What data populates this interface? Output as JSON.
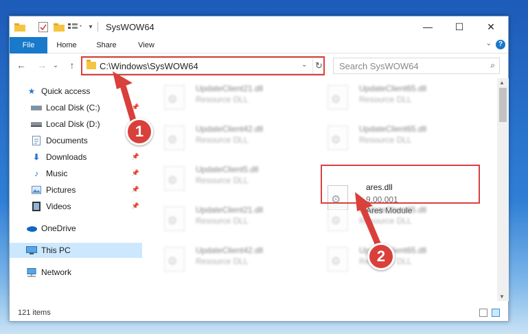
{
  "window": {
    "title": "SysWOW64"
  },
  "title_controls": {
    "minimize": "—",
    "maximize": "☐",
    "close": "✕"
  },
  "ribbon": {
    "tabs": [
      "File",
      "Home",
      "Share",
      "View"
    ],
    "help": "?"
  },
  "address": {
    "path": "C:\\Windows\\SysWOW64"
  },
  "search": {
    "placeholder": "Search SysWOW64"
  },
  "sidebar": {
    "items": [
      {
        "label": "Quick access",
        "icon": "star-icon",
        "pinned": false
      },
      {
        "label": "Local Disk (C:)",
        "icon": "drive-icon",
        "pinned": true
      },
      {
        "label": "Local Disk (D:)",
        "icon": "drive-icon",
        "pinned": true
      },
      {
        "label": "Documents",
        "icon": "documents-icon",
        "pinned": true
      },
      {
        "label": "Downloads",
        "icon": "download-icon",
        "pinned": true
      },
      {
        "label": "Music",
        "icon": "music-icon",
        "pinned": true
      },
      {
        "label": "Pictures",
        "icon": "pictures-icon",
        "pinned": true
      },
      {
        "label": "Videos",
        "icon": "videos-icon",
        "pinned": true
      },
      {
        "label": "OneDrive",
        "icon": "cloud-icon",
        "pinned": false
      },
      {
        "label": "This PC",
        "icon": "computer-icon",
        "pinned": false,
        "selected": true
      },
      {
        "label": "Network",
        "icon": "network-icon",
        "pinned": false
      }
    ]
  },
  "files": [
    {
      "name": "UpdateClient21.dll",
      "desc": "Resource DLL"
    },
    {
      "name": "UpdateClient65.dll",
      "desc": "Resource DLL"
    },
    {
      "name": "UpdateClient42.dll",
      "desc": "Resource DLL"
    },
    {
      "name": "UpdateClient65.dll",
      "desc": "Resource DLL"
    },
    {
      "name": "UpdateClient5.dll",
      "desc": "Resource DLL"
    },
    {
      "name": "ares.dll",
      "version": "9.00.001",
      "desc": "Ares Module"
    },
    {
      "name": "UpdateClient21.dll",
      "desc": "Resource DLL"
    },
    {
      "name": "UpdateClient65.dll",
      "desc": "Resource DLL"
    },
    {
      "name": "UpdateClient42.dll",
      "desc": "Resource DLL"
    },
    {
      "name": "UpdateClient65.dll",
      "desc": "Resource DLL"
    }
  ],
  "status": {
    "item_count": "121 items"
  },
  "annotations": {
    "step1": "1",
    "step2": "2",
    "color": "#d9403c"
  }
}
